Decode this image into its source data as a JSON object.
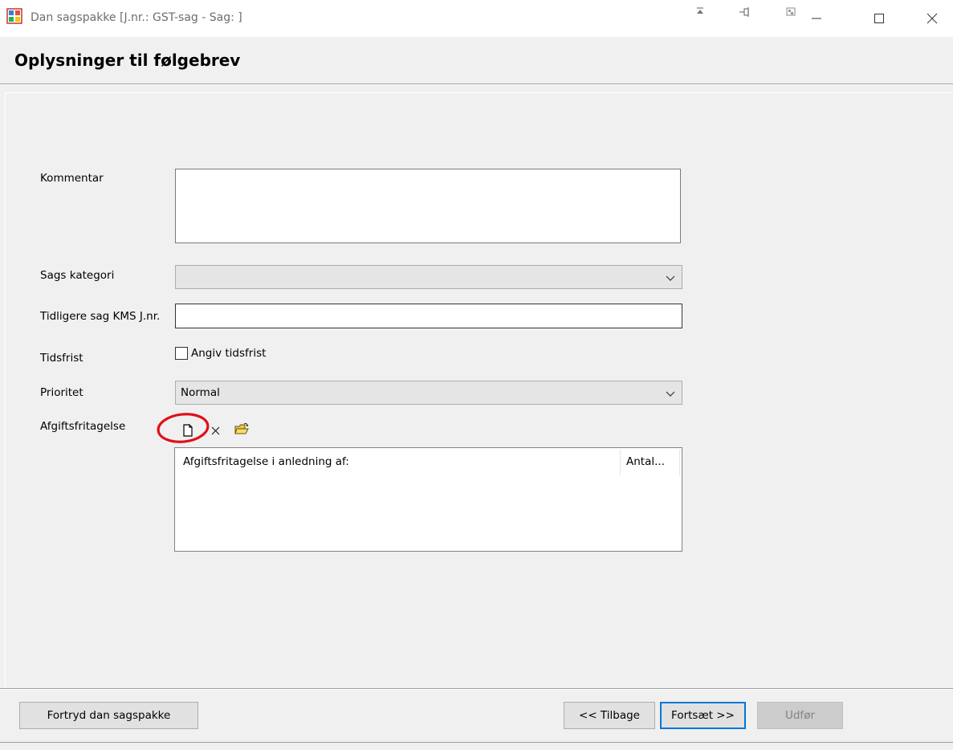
{
  "window": {
    "title": "Dan sagspakke [J.nr.: GST-sag - Sag: ]"
  },
  "page": {
    "title": "Oplysninger til følgebrev"
  },
  "form": {
    "comment_label": "Kommentar",
    "comment_value": "",
    "category_label": "Sags kategori",
    "category_value": "",
    "prev_case_label": "Tidligere sag KMS J.nr.",
    "prev_case_value": "",
    "deadline_label": "Tidsfrist",
    "deadline_checkbox_label": "Angiv tidsfrist",
    "deadline_checked": false,
    "priority_label": "Prioritet",
    "priority_value": "Normal",
    "exemption_label": "Afgiftsfritagelse",
    "exemption_tools": [
      "new-document-icon",
      "delete-x-icon",
      "open-folder-icon"
    ],
    "exemption_columns": [
      "Afgiftsfritagelse i anledning af:",
      "Antal..."
    ]
  },
  "footer": {
    "cancel_label": "Fortryd dan sagspakke",
    "back_label": "<< Tilbage",
    "next_label": "Fortsæt >>",
    "finish_label": "Udfør"
  },
  "colors": {
    "annotation": "#e0101a",
    "focus_border": "#0078d7"
  }
}
